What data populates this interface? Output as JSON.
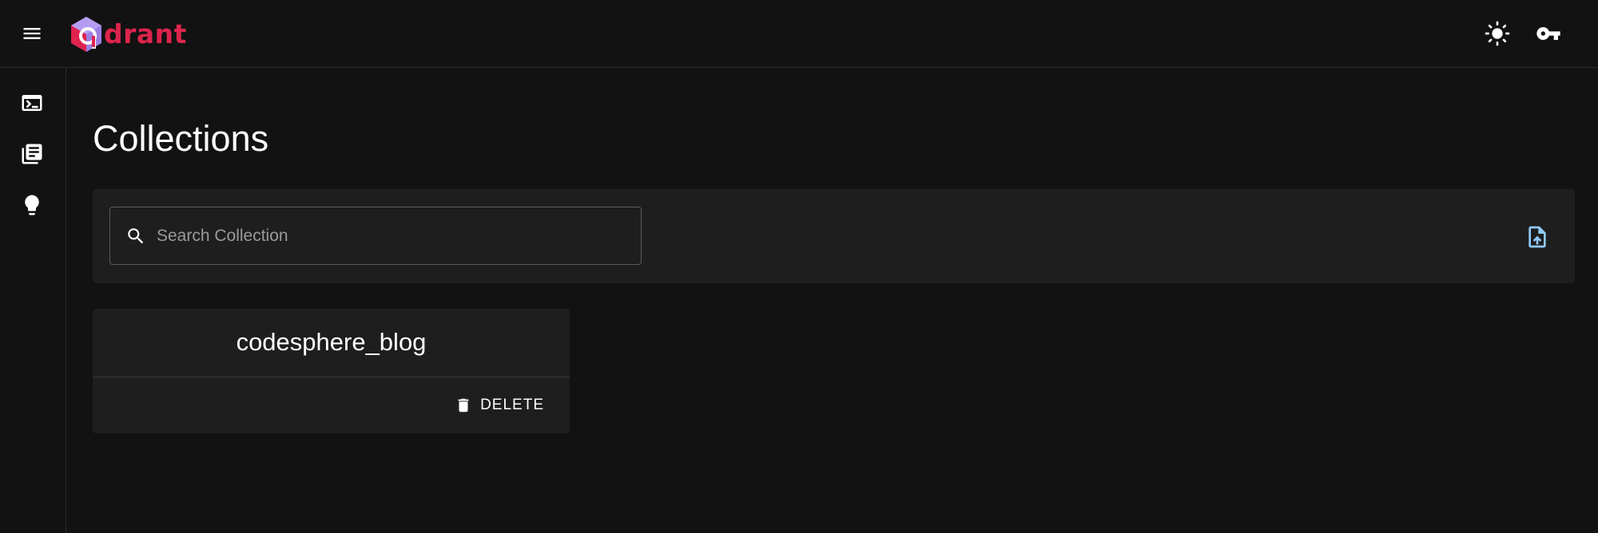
{
  "app": {
    "logo_text": "drant",
    "brand_color": "#dc244c",
    "accent_color": "#90caf9"
  },
  "header": {
    "menu_icon": "menu-icon",
    "theme_icon": "light-mode-icon",
    "api_key_icon": "key-icon"
  },
  "sidebar": {
    "items": [
      {
        "icon": "terminal-icon",
        "name": "console"
      },
      {
        "icon": "library-books-icon",
        "name": "collections"
      },
      {
        "icon": "lightbulb-icon",
        "name": "tutorial"
      }
    ]
  },
  "main": {
    "title": "Collections",
    "search": {
      "placeholder": "Search Collection",
      "value": ""
    },
    "upload_icon": "upload-file-icon",
    "collections": [
      {
        "name": "codesphere_blog",
        "delete_label": "DELETE"
      }
    ]
  }
}
